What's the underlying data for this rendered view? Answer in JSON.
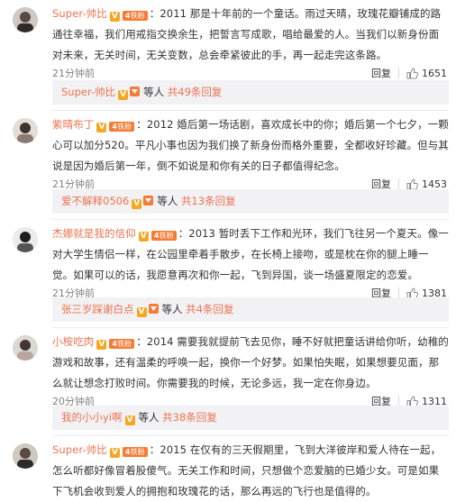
{
  "comments": [
    {
      "username": "Super-帅比",
      "v_mark": "V",
      "fan_label": "铁粉",
      "fan_level": "4",
      "content": "：2011 那是十年前的一个童话。雨过天晴，玫瑰花瓣铺成的路通往幸福，我们用戒指交换余生，把誓言写成歌，唱给最爱的人。当我们以新身份面对未来，无关时间，无关变数，总会牵紧彼此的手，再一起走完这条路。",
      "time": "21分钟前",
      "reply_label": "回复",
      "likes": "1651",
      "subreply": {
        "name": "Super-帅比",
        "mid": "等人",
        "more": "共49条回复"
      }
    },
    {
      "username": "紫晴布丁",
      "v_mark": "V",
      "fan_label": "铁粉",
      "fan_level": "4",
      "content": "：2012 婚后第一场话剧，喜欢成长中的你；婚后第一个七夕，一颗心可以加分520。平凡小事也因为我们换了新身份而格外重要，全都收好珍藏。但与其说是因为婚后第一年，倒不如说是和你有关的日子都值得纪念。",
      "time": "21分钟前",
      "reply_label": "回复",
      "likes": "1453",
      "subreply": {
        "name": "爱不解释0506",
        "mid": "等人",
        "more": "共13条回复"
      }
    },
    {
      "username": "杰娜就是我的信仰",
      "v_mark": "V",
      "fan_label": "铁粉",
      "fan_level": "4",
      "content": "：2013 暂时丢下工作和光环，我们飞往另一个夏天。像一对大学生情侣一样，在公园里牵着手散步，在长椅上接吻，或是枕在你的腿上睡一觉。如果可以的话，我愿意再次和你一起，飞到异国，谈一场盛夏限定的恋爱。",
      "time": "21分钟前",
      "reply_label": "回复",
      "likes": "1381",
      "subreply": {
        "name": "张三岁踩谢白点",
        "mid": "等人",
        "more": "共4条回复"
      }
    },
    {
      "username": "小桉吃肉",
      "v_mark": "V",
      "fan_label": "铁粉",
      "fan_level": "4",
      "content": "：2014 需要我就提前飞去见你，睡不好就把童话讲给你听，幼稚的游戏和故事，还有温柔的呼唤一起，换你一个好梦。如果怕失眠，如果想要见面，那么就让想念打败时间。你需要我的时候，无论多远，我一定在你身边。",
      "time": "20分钟前",
      "reply_label": "回复",
      "likes": "1311",
      "subreply": {
        "name": "我的小小yi啊",
        "mid": "等人",
        "more": "共38条回复"
      }
    },
    {
      "username": "Super-帅比",
      "v_mark": "V",
      "fan_label": "铁粉",
      "fan_level": "4",
      "content": "：2015 在仅有的三天假期里，飞到大洋彼岸和爱人待在一起，怎么听都好像冒着股傻气。无关工作和时间，只想做个恋爱脑的已婚少女。可是如果下飞机会收到爱人的拥抱和玫瑰花的话，那么再远的飞行也是值得的。"
    }
  ],
  "colors": {
    "accent": "#eb7350",
    "subreply_bg": "#f2f2f5",
    "badge": "#f77b34"
  }
}
